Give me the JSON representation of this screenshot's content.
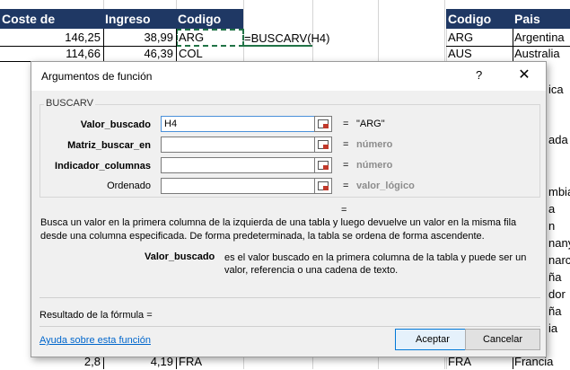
{
  "sheet": {
    "headers": [
      "Coste de Producto",
      "Ingreso Neto",
      "Codigo",
      "Codigo",
      "Pais"
    ],
    "top_rows": [
      {
        "coste": "146,25",
        "ingreso": "38,99",
        "codigo": "ARG"
      },
      {
        "coste": "114,66",
        "ingreso": "46,39",
        "codigo": "COL"
      }
    ],
    "formula_text": "=BUSCARV(H4)",
    "right_rows": [
      {
        "codigo": "ARG",
        "pais": "Argentina"
      },
      {
        "codigo": "AUS",
        "pais": "Australia"
      }
    ],
    "right_partial": [
      "ica",
      "",
      "",
      "ada",
      "",
      "",
      "",
      "mbia",
      "a Rica",
      "n Rep",
      "nany",
      "narca",
      "ña",
      "dor",
      "ña",
      "ia",
      "",
      ""
    ],
    "bottom_row": {
      "coste": "2,8",
      "ingreso": "4,19",
      "codigo": "FRA",
      "codigo2": "FRA",
      "pais": "Francia"
    }
  },
  "dialog": {
    "title": "Argumentos de función",
    "help_glyph": "?",
    "close_glyph": "✕",
    "function_name": "BUSCARV",
    "args": [
      {
        "label": "Valor_buscado",
        "bold": true,
        "value": "H4",
        "result": "\"ARG\"",
        "hint": false
      },
      {
        "label": "Matriz_buscar_en",
        "bold": true,
        "value": "",
        "result": "número",
        "hint": true
      },
      {
        "label": "Indicador_columnas",
        "bold": true,
        "value": "",
        "result": "número",
        "hint": true
      },
      {
        "label": "Ordenado",
        "bold": false,
        "value": "",
        "result": "valor_lógico",
        "hint": true
      }
    ],
    "eq_sign": "=",
    "description": "Busca un valor en la primera columna de la izquierda de una tabla y luego devuelve un valor en la misma fila desde una columna especificada. De forma predeterminada, la tabla se ordena de forma ascendente.",
    "param_name": "Valor_buscado",
    "param_description": "es el valor buscado en la primera columna de la tabla y puede ser un valor, referencia o una cadena de texto.",
    "result_label": "Resultado de la fórmula =",
    "help_link": "Ayuda sobre esta función",
    "ok_label": "Aceptar",
    "cancel_label": "Cancelar"
  }
}
